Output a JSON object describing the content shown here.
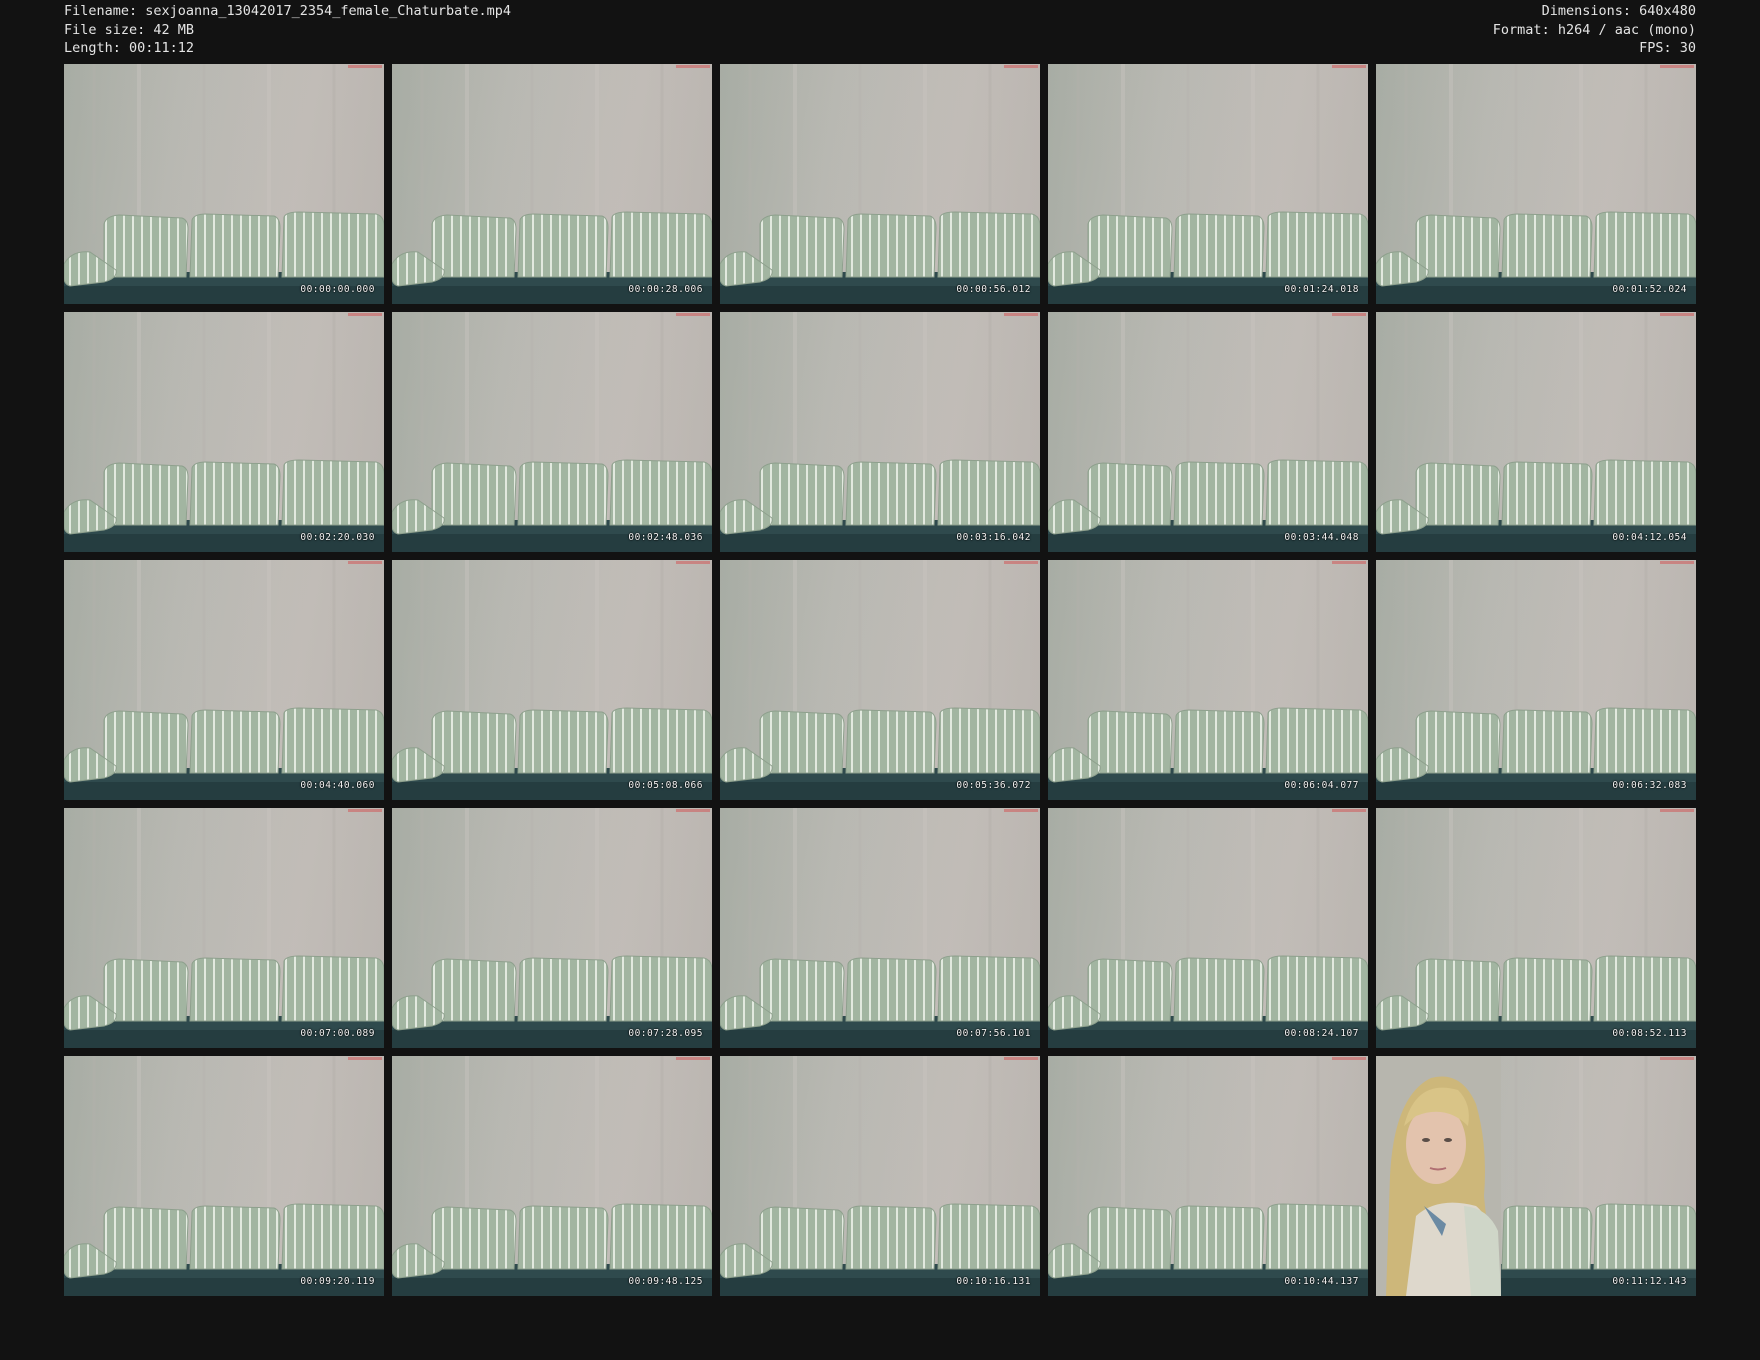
{
  "header": {
    "filename": "Filename: sexjoanna_13042017_2354_female_Chaturbate.mp4",
    "filesize": "File size: 42 MB",
    "length": "Length: 00:11:12",
    "dimensions": "Dimensions: 640x480",
    "format": "Format: h264 / aac (mono)",
    "fps": "FPS: 30"
  },
  "thumbnails": [
    {
      "timestamp": "00:00:00.000",
      "person": false
    },
    {
      "timestamp": "00:00:28.006",
      "person": false
    },
    {
      "timestamp": "00:00:56.012",
      "person": false
    },
    {
      "timestamp": "00:01:24.018",
      "person": false
    },
    {
      "timestamp": "00:01:52.024",
      "person": false
    },
    {
      "timestamp": "00:02:20.030",
      "person": false
    },
    {
      "timestamp": "00:02:48.036",
      "person": false
    },
    {
      "timestamp": "00:03:16.042",
      "person": false
    },
    {
      "timestamp": "00:03:44.048",
      "person": false
    },
    {
      "timestamp": "00:04:12.054",
      "person": false
    },
    {
      "timestamp": "00:04:40.060",
      "person": false
    },
    {
      "timestamp": "00:05:08.066",
      "person": false
    },
    {
      "timestamp": "00:05:36.072",
      "person": false
    },
    {
      "timestamp": "00:06:04.077",
      "person": false
    },
    {
      "timestamp": "00:06:32.083",
      "person": false
    },
    {
      "timestamp": "00:07:00.089",
      "person": false
    },
    {
      "timestamp": "00:07:28.095",
      "person": false
    },
    {
      "timestamp": "00:07:56.101",
      "person": false
    },
    {
      "timestamp": "00:08:24.107",
      "person": false
    },
    {
      "timestamp": "00:08:52.113",
      "person": false
    },
    {
      "timestamp": "00:09:20.119",
      "person": false
    },
    {
      "timestamp": "00:09:48.125",
      "person": false
    },
    {
      "timestamp": "00:10:16.131",
      "person": false
    },
    {
      "timestamp": "00:10:44.137",
      "person": false
    },
    {
      "timestamp": "00:11:12.143",
      "person": true
    }
  ],
  "colors": {
    "background": "#121212",
    "text": "#e4e4e4",
    "wall": "#bcb9b3",
    "cushion": "#a3b8a3",
    "couch_base": "#2f4a4d"
  }
}
